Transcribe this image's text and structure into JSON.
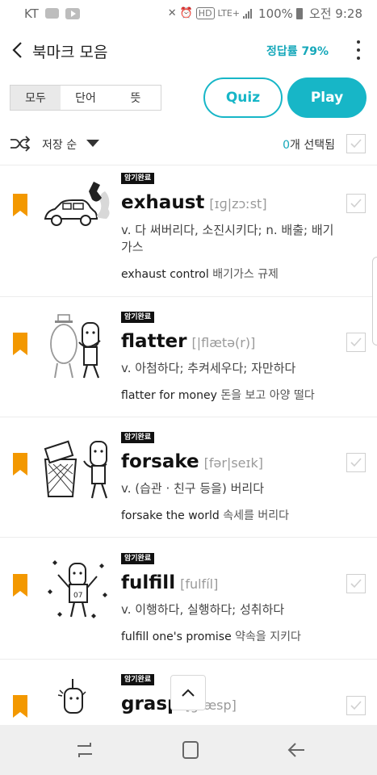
{
  "status_bar": {
    "carrier": "KT",
    "lte": "LTE+",
    "hd": "HD",
    "battery": "100%",
    "time": "오전 9:28"
  },
  "header": {
    "title": "북마크 모음",
    "accuracy": "정답률 79%"
  },
  "filter": {
    "segments": [
      "모두",
      "단어",
      "뜻"
    ],
    "selected_index": 0,
    "quiz_label": "Quiz",
    "play_label": "Play"
  },
  "sort": {
    "label": "저장 순",
    "selected_count": "0",
    "selected_suffix": "개 선택됨"
  },
  "words": [
    {
      "badge": "암기완료",
      "word": "exhaust",
      "pron": "[ɪɡ|zɔːst]",
      "meaning": "v. 다 써버리다, 소진시키다; n. 배출; 배기가스",
      "example_en": "exhaust control",
      "example_kr": "배기가스 규제",
      "illustration": "car-exhaust-illustration"
    },
    {
      "badge": "암기완료",
      "word": "flatter",
      "pron": "[|flætə(r)]",
      "meaning": "v. 아첨하다; 추켜세우다; 자만하다",
      "example_en": "flatter for money",
      "example_kr": "돈을 보고 아양 떨다",
      "illustration": "flatterer-illustration"
    },
    {
      "badge": "암기완료",
      "word": "forsake",
      "pron": "[fər|seɪk]",
      "meaning": "v. (습관 · 친구 등을) 버리다",
      "example_en": "forsake the world",
      "example_kr": "속세를 버리다",
      "illustration": "trash-bin-illustration"
    },
    {
      "badge": "암기완료",
      "word": "fulfill",
      "pron": "[fulfíl]",
      "meaning": "v. 이행하다, 실행하다; 성취하다",
      "example_en": "fulfill one's promise",
      "example_kr": "약속을 지키다",
      "illustration": "champion-illustration"
    },
    {
      "badge": "암기완료",
      "word": "grasp",
      "pron": "[ɡræsp]",
      "illustration": "grasp-illustration"
    }
  ],
  "colors": {
    "accent": "#17b6c7",
    "bookmark": "#f39800"
  }
}
